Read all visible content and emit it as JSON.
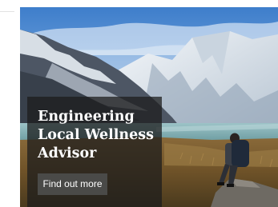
{
  "promo": {
    "title": "Engineering Local Wellness Advisor",
    "button_label": "Find out more",
    "image_subject": "hiker-sitting-on-rock-mountain-lake-photo"
  },
  "colors": {
    "overlay": "#1c1c1c",
    "button": "#4a4a48",
    "text": "#ffffff"
  }
}
